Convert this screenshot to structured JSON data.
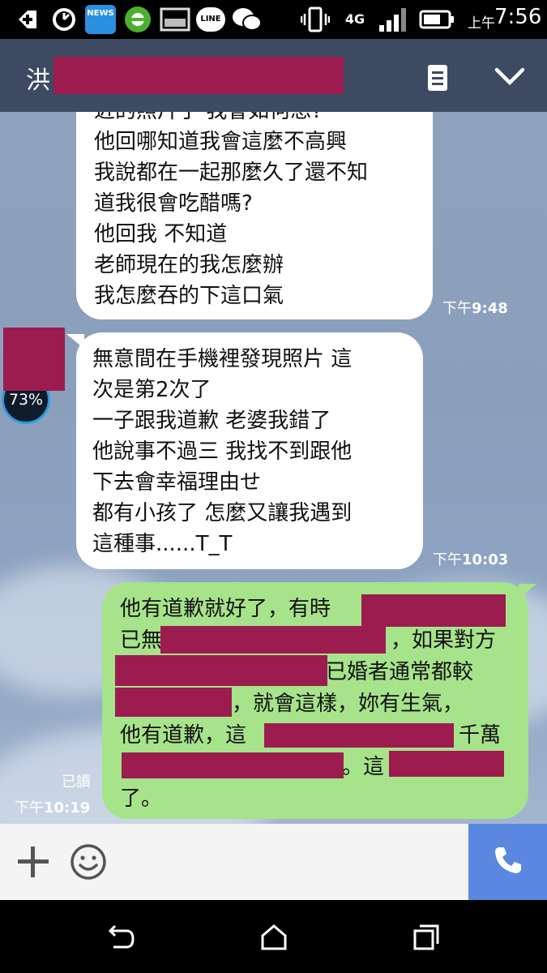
{
  "status_bar": {
    "time_prefix": "上午",
    "time": "7:56",
    "network": "4G",
    "news_label": "NEWS",
    "line_label": "LINE",
    "icons": [
      "add-icon",
      "sync-icon",
      "news-app-icon",
      "ie-browser-icon",
      "gallery-icon",
      "line-app-icon",
      "wechat-icon",
      "vibrate-icon",
      "network-4g-icon",
      "signal-icon",
      "battery-icon"
    ]
  },
  "header": {
    "title": "洪",
    "title_redacted": true,
    "icons": [
      "notes-icon",
      "chevron-down-icon"
    ]
  },
  "avatar": {
    "badge": "73%"
  },
  "messages": [
    {
      "direction": "incoming",
      "lines": [
        "近的照片了 我會如何想?",
        "他回哪知道我會這麼不高興",
        "我說都在一起那麼久了還不知",
        "道我很會吃醋嗎?",
        "他回我 不知道",
        "老師現在的我怎麼辦",
        "我怎麼吞的下這口氣"
      ],
      "time_prefix": "下午",
      "time": "9:48"
    },
    {
      "direction": "incoming",
      "lines": [
        "無意間在手機裡發現照片 這",
        "次是第2次了",
        "一子跟我道歉 老婆我錯了",
        "他說事不過三 我找不到跟他",
        "下去會幸福理由せ",
        "都有小孩了 怎麼又讓我遇到",
        "這種事......T_T"
      ],
      "time_prefix": "下午",
      "time": "10:03"
    },
    {
      "direction": "outgoing",
      "lines": [
        "他有道歉就好了，有時",
        "已無",
        "，如果對方",
        "已婚者通常都較",
        "，就會這樣，妳有生氣，",
        "他有道歉，這",
        "千萬",
        "。這",
        "了。"
      ],
      "read_label": "已讀",
      "time_prefix": "下午",
      "time": "10:19"
    }
  ],
  "input_bar": {
    "icons": [
      "plus-icon",
      "emoji-icon",
      "phone-icon"
    ]
  },
  "nav_bar": {
    "icons": [
      "back-icon",
      "home-icon",
      "recents-icon"
    ]
  },
  "colors": {
    "header_bg": "#3d4a62",
    "chat_bg": "#8fa2bd",
    "incoming_bubble": "#ffffff",
    "outgoing_bubble": "#a6e38a",
    "redaction": "#9c1c4f",
    "call_button": "#5c87e0"
  }
}
